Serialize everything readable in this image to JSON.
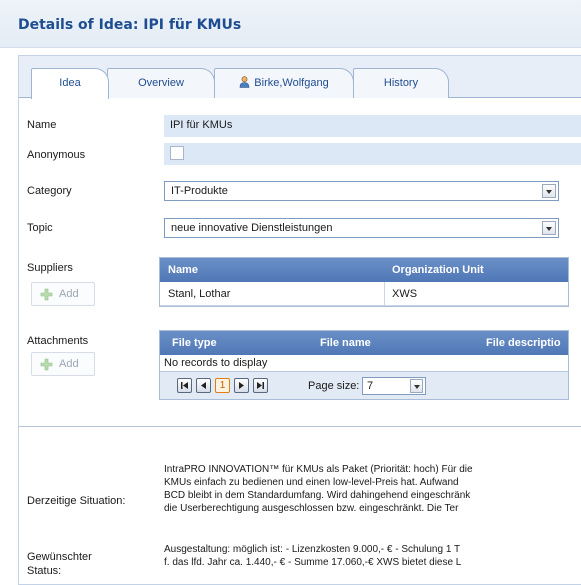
{
  "page": {
    "title": "Details of Idea: IPI für KMUs"
  },
  "tabs": [
    {
      "label": "Idea"
    },
    {
      "label": "Overview"
    },
    {
      "label": "Birke,Wolfgang",
      "icon": "person-icon"
    },
    {
      "label": "History"
    }
  ],
  "fields": {
    "name": {
      "label": "Name",
      "value": "IPI für KMUs"
    },
    "anonymous": {
      "label": "Anonymous"
    },
    "category": {
      "label": "Category",
      "value": "IT-Produkte"
    },
    "topic": {
      "label": "Topic",
      "value": "neue innovative Dienstleistungen"
    }
  },
  "suppliers": {
    "label": "Suppliers",
    "add_label": "Add",
    "columns": [
      "Name",
      "Organization Unit"
    ],
    "rows": [
      [
        "Stanl, Lothar",
        "XWS"
      ]
    ]
  },
  "attachments": {
    "label": "Attachments",
    "add_label": "Add",
    "columns": [
      "File type",
      "File name",
      "File descriptio"
    ],
    "empty_text": "No records to display",
    "pager": {
      "current_page": "1",
      "page_size_label": "Page size:",
      "page_size_value": "7"
    }
  },
  "situation": {
    "label": "Derzeitige Situation:",
    "lines": [
      "IntraPRO INNOVATION™ für KMUs als Paket (Priorität: hoch) Für die",
      "KMUs einfach zu bedienen und einen low-level-Preis hat. Aufwand",
      "BCD bleibt in dem Standardumfang. Wird dahingehend eingeschränk",
      "die Userberechtigung ausgeschlossen bzw. eingeschränkt. Die Ter"
    ]
  },
  "desired": {
    "label_line1": "Gewünschter",
    "label_line2": "Status:",
    "lines": [
      "Ausgestaltung: möglich ist: - Lizenzkosten 9.000,- € - Schulung 1 T",
      "f. das lfd. Jahr ca. 1.440,- € - Summe 17.060,-€ XWS bietet diese L"
    ]
  },
  "colors": {
    "accent": "#1f4d91",
    "grid_header": "#5a80bd",
    "field_bg": "#dde8f6"
  }
}
